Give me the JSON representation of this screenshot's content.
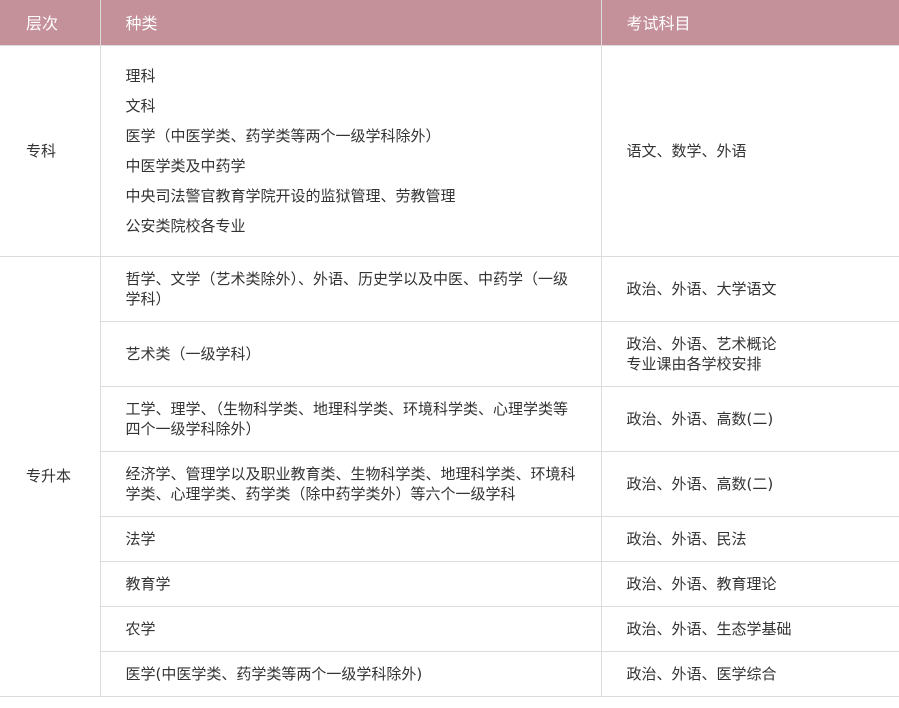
{
  "header": {
    "col_level": "层次",
    "col_category": "种类",
    "col_subjects": "考试科目"
  },
  "zhuanke": {
    "level": "专科",
    "categories": [
      "理科",
      "文科",
      "医学（中医学类、药学类等两个一级学科除外）",
      "中医学类及中药学",
      "中央司法警官教育学院开设的监狱管理、劳教管理",
      "公安类院校各专业"
    ],
    "subjects": "语文、数学、外语"
  },
  "zhuanshengben": {
    "level": "专升本",
    "rows": [
      {
        "category": "哲学、文学（艺术类除外）、外语、历史学以及中医、中药学（一级学科）",
        "subjects": "政治、外语、大学语文"
      },
      {
        "category": "艺术类（一级学科）",
        "subjects": "政治、外语、艺术概论",
        "subjects_note": "专业课由各学校安排"
      },
      {
        "category": "工学、理学、（生物科学类、地理科学类、环境科学类、心理学类等四个一级学科除外）",
        "subjects": "政治、外语、高数(二)"
      },
      {
        "category": "经济学、管理学以及职业教育类、生物科学类、地理科学类、环境科学类、心理学类、药学类（除中药学类外）等六个一级学科",
        "subjects": "政治、外语、高数(二)"
      },
      {
        "category": "法学",
        "subjects": "政治、外语、民法"
      },
      {
        "category": "教育学",
        "subjects": "政治、外语、教育理论"
      },
      {
        "category": "农学",
        "subjects": "政治、外语、生态学基础"
      },
      {
        "category": "医学(中医学类、药学类等两个一级学科除外)",
        "subjects": "政治、外语、医学综合"
      }
    ]
  }
}
